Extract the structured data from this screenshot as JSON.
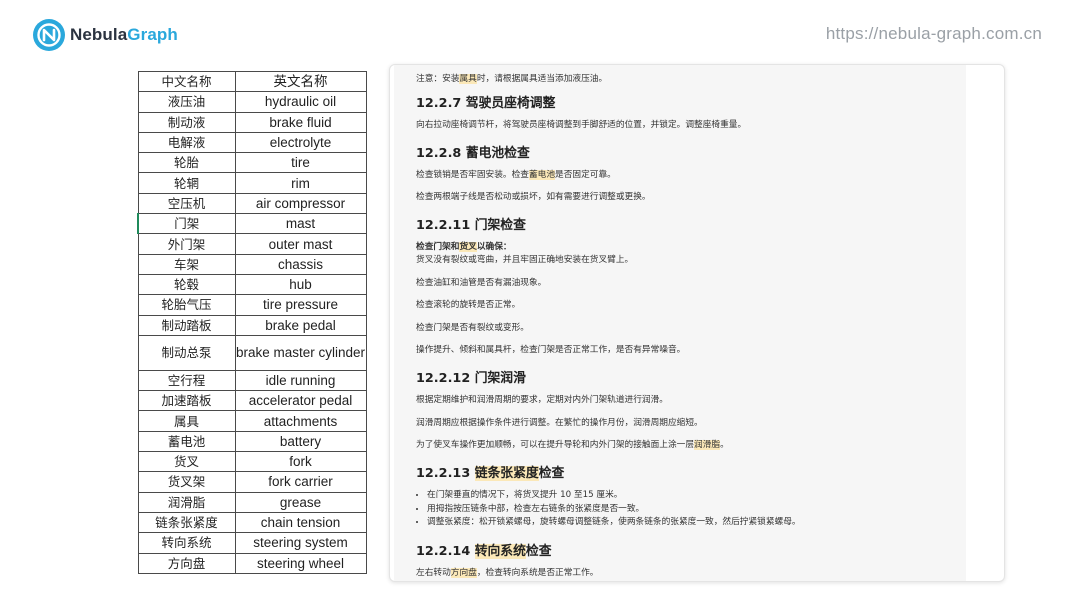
{
  "header": {
    "logo_text_primary": "Nebula",
    "logo_text_accent": "Graph",
    "logo_icon": "nebula-logo-icon",
    "url": "https://nebula-graph.com.cn",
    "brand_color": "#2aa8dc"
  },
  "glossary": {
    "col_cn": "中文名称",
    "col_en": "英文名称",
    "rows": [
      {
        "cn": "液压油",
        "en": "hydraulic oil"
      },
      {
        "cn": "制动液",
        "en": "brake fluid"
      },
      {
        "cn": "电解液",
        "en": "electrolyte"
      },
      {
        "cn": "轮胎",
        "en": "tire"
      },
      {
        "cn": "轮辋",
        "en": "rim"
      },
      {
        "cn": "空压机",
        "en": "air compressor"
      },
      {
        "cn": "门架",
        "en": "mast"
      },
      {
        "cn": "外门架",
        "en": "outer mast"
      },
      {
        "cn": "车架",
        "en": "chassis"
      },
      {
        "cn": "轮毂",
        "en": "hub"
      },
      {
        "cn": "轮胎气压",
        "en": "tire pressure"
      },
      {
        "cn": "制动踏板",
        "en": "brake pedal"
      },
      {
        "cn": "制动总泵",
        "en": "brake master cylinder"
      },
      {
        "cn": "空行程",
        "en": "idle running"
      },
      {
        "cn": "加速踏板",
        "en": "accelerator pedal"
      },
      {
        "cn": "属具",
        "en": "attachments"
      },
      {
        "cn": "蓄电池",
        "en": "battery"
      },
      {
        "cn": "货叉",
        "en": "fork"
      },
      {
        "cn": "货叉架",
        "en": "fork carrier"
      },
      {
        "cn": "润滑脂",
        "en": "grease"
      },
      {
        "cn": "链条张紧度",
        "en": "chain tension"
      },
      {
        "cn": "转向系统",
        "en": "steering system"
      },
      {
        "cn": "方向盘",
        "en": "steering wheel"
      }
    ]
  },
  "doc": {
    "note_pre": "注意：安装",
    "note_hl": "属具",
    "note_post": "时，请根据属具适当添加液压油。",
    "s1_title": "12.2.7 驾驶员座椅调整",
    "s1_p1": "向右拉动座椅调节杆，将驾驶员座椅调整到手脚舒适的位置，并锁定。调整座椅重量。",
    "s2_title": "12.2.8 蓄电池检查",
    "s2_p1_pre": "检查锁销是否牢固安装。检查",
    "s2_p1_hl": "蓄电池",
    "s2_p1_post": "是否固定可靠。",
    "s2_p2": "检查两根端子线是否松动或损坏，如有需要进行调整或更换。",
    "s3_title": "12.2.11 门架检查",
    "s3_lead_pre": "检查门架和",
    "s3_lead_hl": "货叉",
    "s3_lead_post": "以确保：",
    "s3_p1": "货叉没有裂纹或弯曲，并且牢固正确地安装在货叉臂上。",
    "s3_p2": "检查油缸和油管是否有漏油现象。",
    "s3_p3": "检查滚轮的旋转是否正常。",
    "s3_p4": "检查门架是否有裂纹或变形。",
    "s3_p5": "操作提升、倾斜和属具杆，检查门架是否正常工作，是否有异常噪音。",
    "s4_title": "12.2.12 门架润滑",
    "s4_p1": "根据定期维护和润滑周期的要求，定期对内外门架轨道进行润滑。",
    "s4_p2": "润滑周期应根据操作条件进行调整。在繁忙的操作月份，润滑周期应缩短。",
    "s4_p3_pre": "为了使叉车操作更加顺畅，可以在提升导轮和内外门架的接触面上涂一层",
    "s4_p3_hl": "润滑脂",
    "s4_p3_post": "。",
    "s5_title_pre": "12.2.13 ",
    "s5_title_hl": "链条张紧度",
    "s5_title_post": "检查",
    "s5_li1": "在门架垂直的情况下，将货叉提升 10 至15 厘米。",
    "s5_li2": "用拇指按压链条中部，检查左右链条的张紧度是否一致。",
    "s5_li3": "调整张紧度：松开锁紧螺母，旋转螺母调整链条，使两条链条的张紧度一致，然后拧紧锁紧螺母。",
    "s6_title_pre": "12.2.14 ",
    "s6_title_hl": "转向系统",
    "s6_title_post": "检查",
    "s6_p1_pre": "左右转动",
    "s6_p1_hl": "方向盘",
    "s6_p1_post": "，检查转向系统是否正常工作。",
    "highlight_color": "#fbe8b8"
  }
}
